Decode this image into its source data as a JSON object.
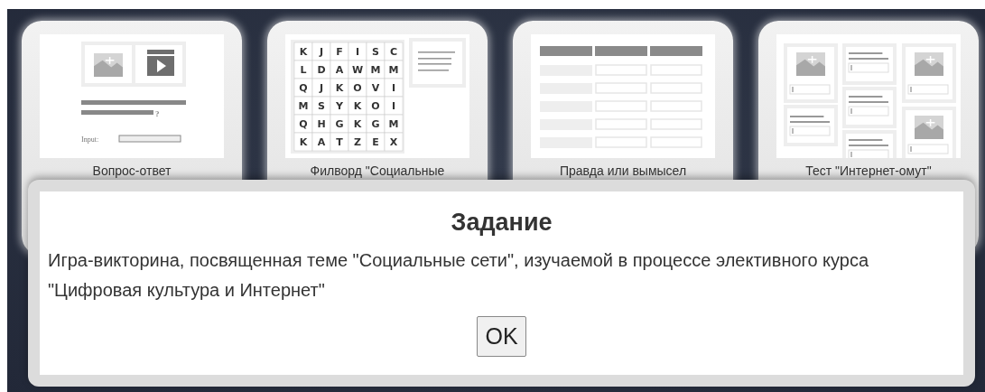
{
  "cards": [
    {
      "kind": "quiz",
      "title": "Вопрос-ответ",
      "question_mark": "?",
      "input_label": "Input:"
    },
    {
      "kind": "wordsearch",
      "title": "Филворд \"Социальные",
      "grid": [
        [
          "K",
          "J",
          "F",
          "I",
          "S",
          "C"
        ],
        [
          "L",
          "D",
          "A",
          "W",
          "M",
          "M"
        ],
        [
          "Q",
          "J",
          "K",
          "O",
          "V",
          "I"
        ],
        [
          "M",
          "S",
          "Y",
          "K",
          "O",
          "I"
        ],
        [
          "Q",
          "H",
          "G",
          "K",
          "G",
          "M"
        ],
        [
          "K",
          "A",
          "T",
          "Z",
          "E",
          "X"
        ]
      ]
    },
    {
      "kind": "table",
      "title": "Правда или вымысел"
    },
    {
      "kind": "test",
      "title": "Тест \"Интернет-омут\""
    }
  ],
  "dialog": {
    "title": "Задание",
    "message": "Игра-викторина, посвященная теме \"Социальные сети\", изучаемой в процессе элективного курса \"Цифровая культура и Интернет\"",
    "button": "OK"
  }
}
